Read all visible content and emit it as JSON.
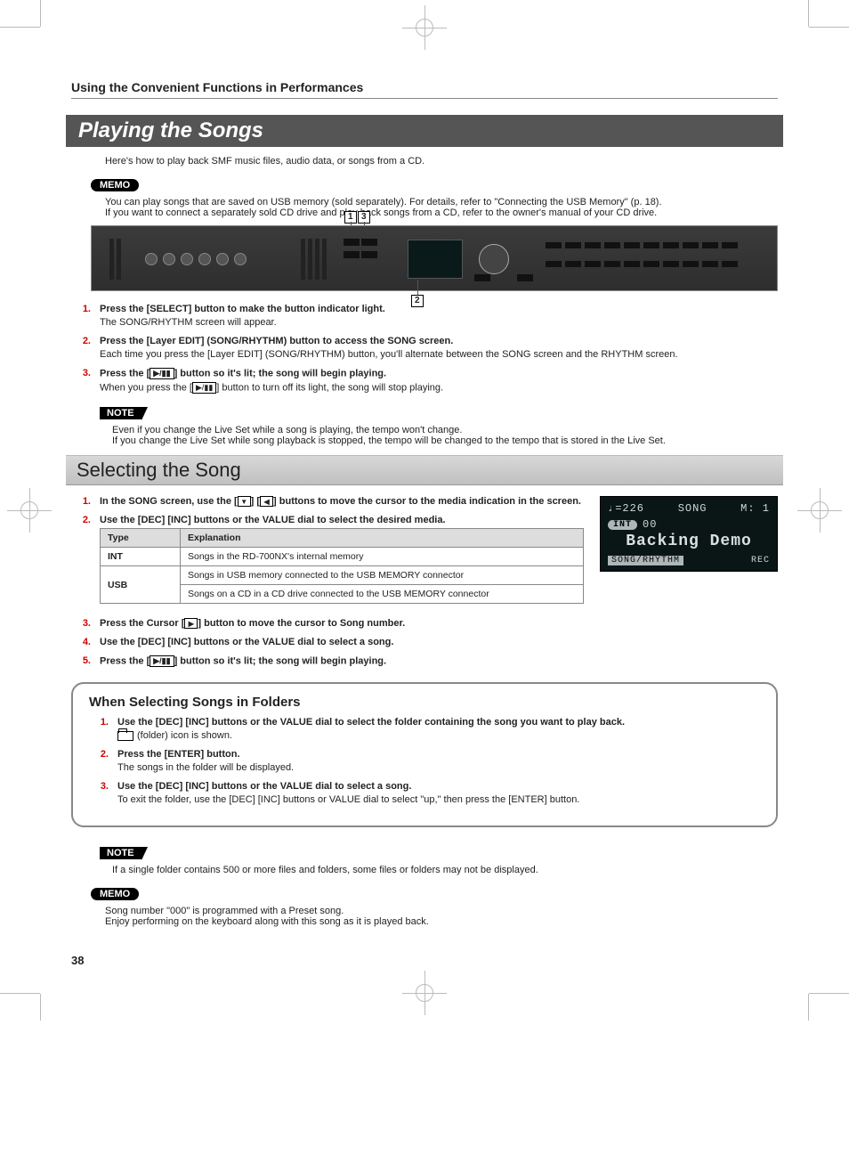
{
  "breadcrumb": "Using the Convenient Functions in Performances",
  "h1": "Playing the Songs",
  "intro": "Here's how to play back SMF music files, audio data, or songs from a CD.",
  "memo1": {
    "label": "MEMO",
    "lines": [
      "You can play songs that are saved on USB memory (sold separately). For details, refer to \"Connecting the USB Memory\" (p. 18).",
      "If you want to connect a separately sold CD drive and play back songs from a CD, refer to the owner's manual of your CD drive."
    ]
  },
  "figure": {
    "labels": {
      "n1": "1",
      "n2": "2",
      "n3": "3"
    }
  },
  "steps1": [
    {
      "num": "1.",
      "title": "Press the [SELECT] button to make the button indicator light.",
      "desc": "The SONG/RHYTHM screen will appear."
    },
    {
      "num": "2.",
      "title": "Press the [Layer EDIT] (SONG/RHYTHM) button to access the SONG screen.",
      "desc": "Each time you press the [Layer EDIT] (SONG/RHYTHM) button, you'll alternate between the SONG screen and the RHYTHM screen."
    },
    {
      "num": "3.",
      "title_pre": "Press the [",
      "title_post": "] button so it's lit; the song will begin playing.",
      "desc_pre": "When you press the [",
      "desc_post": "] button to turn off its light, the song will stop playing."
    }
  ],
  "note1": {
    "label": "NOTE",
    "lines": [
      "Even if you change the Live Set while a song is playing, the tempo won't change.",
      "If you change the Live Set while song playback is stopped, the tempo will be changed to the tempo that is stored in the Live Set."
    ]
  },
  "h2": "Selecting the Song",
  "steps2a": [
    {
      "num": "1.",
      "title_pre": "In the SONG screen, use the [",
      "title_mid": "] [",
      "title_post": "] buttons to move the cursor to the media indication in the screen."
    },
    {
      "num": "2.",
      "title": "Use the [DEC] [INC] buttons or the VALUE dial to select the desired media."
    }
  ],
  "lcd": {
    "tempo": "♩=226",
    "mode": "SONG",
    "meas": "M:  1",
    "int": "INT",
    "num": "00",
    "title": "Backing Demo",
    "foot_l": "SONG/RHYTHM",
    "foot_r": "REC"
  },
  "table": {
    "head": {
      "type": "Type",
      "expl": "Explanation"
    },
    "rows": [
      {
        "type": "INT",
        "expl": [
          "Songs in the RD-700NX's internal memory"
        ]
      },
      {
        "type": "USB",
        "expl": [
          "Songs in USB memory connected to the USB MEMORY connector",
          "Songs on a CD in a CD drive connected to the USB MEMORY connector"
        ]
      }
    ]
  },
  "steps2b": [
    {
      "num": "3.",
      "title_pre": "Press the Cursor [",
      "title_post": "] button to move the cursor to Song number."
    },
    {
      "num": "4.",
      "title": "Use the [DEC] [INC] buttons or the VALUE dial to select a song."
    },
    {
      "num": "5.",
      "title_pre": "Press the [",
      "title_post": "] button so it's lit; the song will begin playing."
    }
  ],
  "folder_box": {
    "heading": "When Selecting Songs in Folders",
    "steps": [
      {
        "num": "1.",
        "title": "Use the [DEC] [INC] buttons or the VALUE dial to select the folder containing the song you want to play back.",
        "desc": "(folder) icon is shown."
      },
      {
        "num": "2.",
        "title": "Press the [ENTER] button.",
        "desc": "The songs in the folder will be displayed."
      },
      {
        "num": "3.",
        "title": "Use the [DEC] [INC] buttons or the VALUE dial to select a song.",
        "desc": "To exit the folder, use the [DEC] [INC] buttons or VALUE dial to select \"up,\" then press the [ENTER] button."
      }
    ]
  },
  "note2": {
    "label": "NOTE",
    "lines": [
      "If a single folder contains 500 or more files and folders, some files or folders may not be displayed."
    ]
  },
  "memo2": {
    "label": "MEMO",
    "lines": [
      "Song number \"000\" is programmed with a Preset song.",
      "Enjoy performing on the keyboard along with this song as it is played back."
    ]
  },
  "page": "38"
}
